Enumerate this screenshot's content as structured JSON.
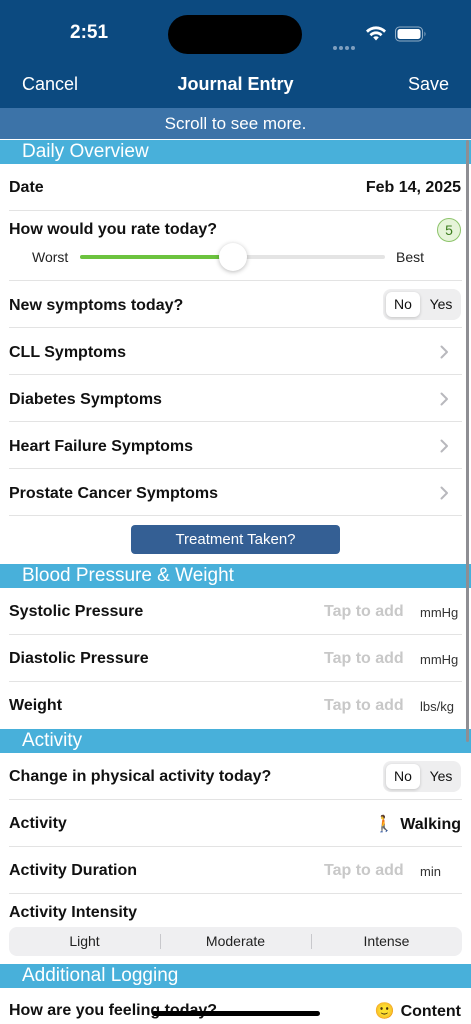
{
  "status_bar": {
    "time": "2:51"
  },
  "nav": {
    "cancel": "Cancel",
    "title": "Journal Entry",
    "save": "Save"
  },
  "scroll_hint": "Scroll to see more.",
  "daily_overview": {
    "header": "Daily Overview",
    "date_label": "Date",
    "date_value": "Feb 14, 2025",
    "rating_label": "How would you rate today?",
    "rating_value": "5",
    "rating_fraction": 0.5,
    "slider_min_label": "Worst",
    "slider_max_label": "Best",
    "new_symptoms_label": "New symptoms today?",
    "new_symptoms_options": [
      "No",
      "Yes"
    ],
    "symptom_rows": [
      "CLL Symptoms",
      "Diabetes Symptoms",
      "Heart Failure Symptoms",
      "Prostate Cancer Symptoms"
    ],
    "treatment_button": "Treatment Taken?"
  },
  "bp_weight": {
    "header": "Blood Pressure & Weight",
    "rows": [
      {
        "label": "Systolic Pressure",
        "placeholder": "Tap to add",
        "unit": "mmHg"
      },
      {
        "label": "Diastolic Pressure",
        "placeholder": "Tap to add",
        "unit": "mmHg"
      },
      {
        "label": "Weight",
        "placeholder": "Tap to add",
        "unit": "lbs/kg"
      }
    ]
  },
  "activity": {
    "header": "Activity",
    "change_label": "Change in physical activity today?",
    "change_options": [
      "No",
      "Yes"
    ],
    "activity_label": "Activity",
    "activity_emoji": "🚶",
    "activity_value": "Walking",
    "duration_label": "Activity Duration",
    "duration_placeholder": "Tap to add",
    "duration_unit": "min",
    "intensity_label": "Activity Intensity",
    "intensity_options": [
      "Light",
      "Moderate",
      "Intense"
    ]
  },
  "additional": {
    "header": "Additional Logging",
    "feeling_label": "How are you feeling today?",
    "feeling_emoji": "🙂",
    "feeling_value": "Content"
  },
  "colors": {
    "nav_bg": "#0c4a80",
    "hint_bg": "#3c73a8",
    "section_bg": "#48b0da",
    "slider_fill": "#6cc33e",
    "button_bg": "#345f94"
  }
}
